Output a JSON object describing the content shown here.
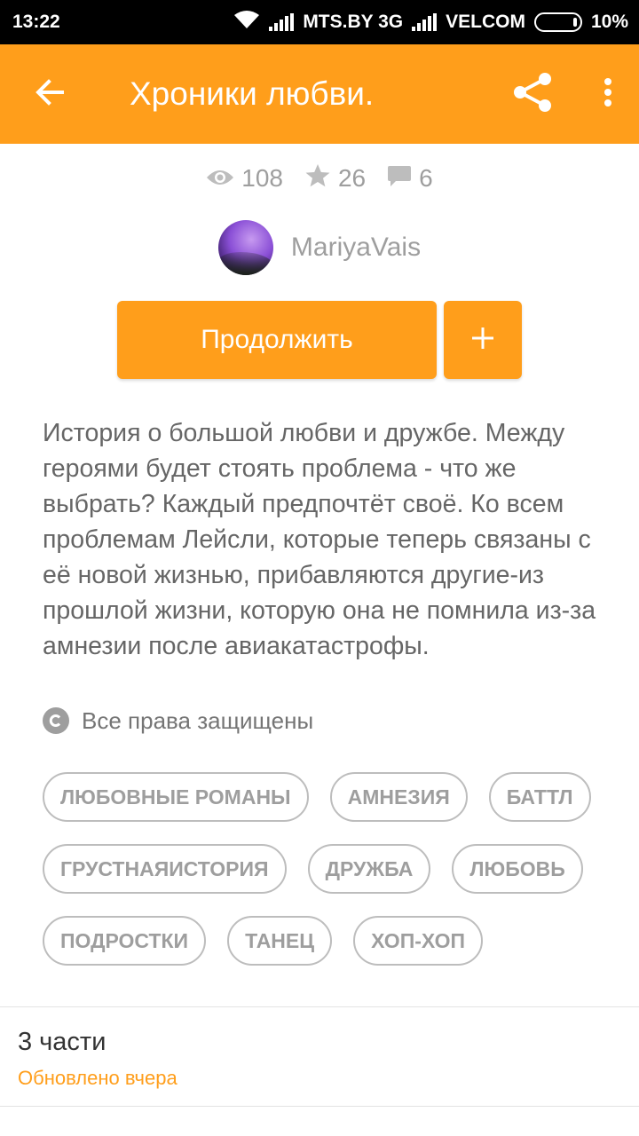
{
  "status_bar": {
    "time": "13:22",
    "carrier1": "MTS.BY 3G",
    "carrier2": "VELCOM",
    "battery": "10%",
    "icons": [
      "wifi-icon",
      "signal-icon",
      "battery-icon"
    ]
  },
  "app_bar": {
    "title": "Хроники любви.",
    "icons": [
      "arrow-back-icon",
      "share-icon",
      "more-vertical-icon"
    ],
    "background": "#FF9E1B"
  },
  "stats": {
    "views": "108",
    "votes": "26",
    "comments": "6"
  },
  "author": {
    "name": "MariyaVais"
  },
  "actions": {
    "continue_label": "Продолжить",
    "add_icon": "plus-icon"
  },
  "description": "История о большой любви и дружбе. Между героями будет стоять проблема - что же выбрать? Каждый предпочтёт своё. Ко всем проблемам Лейсли, которые теперь связаны с её новой жизнью, прибавляются другие-из прошлой жизни, которую она не помнила из-за амнезии после авиакатастрофы.",
  "copyright": {
    "label": "Все права защищены"
  },
  "tags": [
    "ЛЮБОВНЫЕ РОМАНЫ",
    "АМНЕЗИЯ",
    "БАТТЛ",
    "ГРУСТНАЯИСТОРИЯ",
    "ДРУЖБА",
    "ЛЮБОВЬ",
    "ПОДРОСТКИ",
    "ТАНЕЦ",
    "ХОП-ХОП"
  ],
  "parts": {
    "count_label": "3 части",
    "updated_label": "Обновлено вчера"
  },
  "colors": {
    "accent": "#FF9E1B",
    "muted_text": "#9e9e9e",
    "body_text": "#666666"
  }
}
